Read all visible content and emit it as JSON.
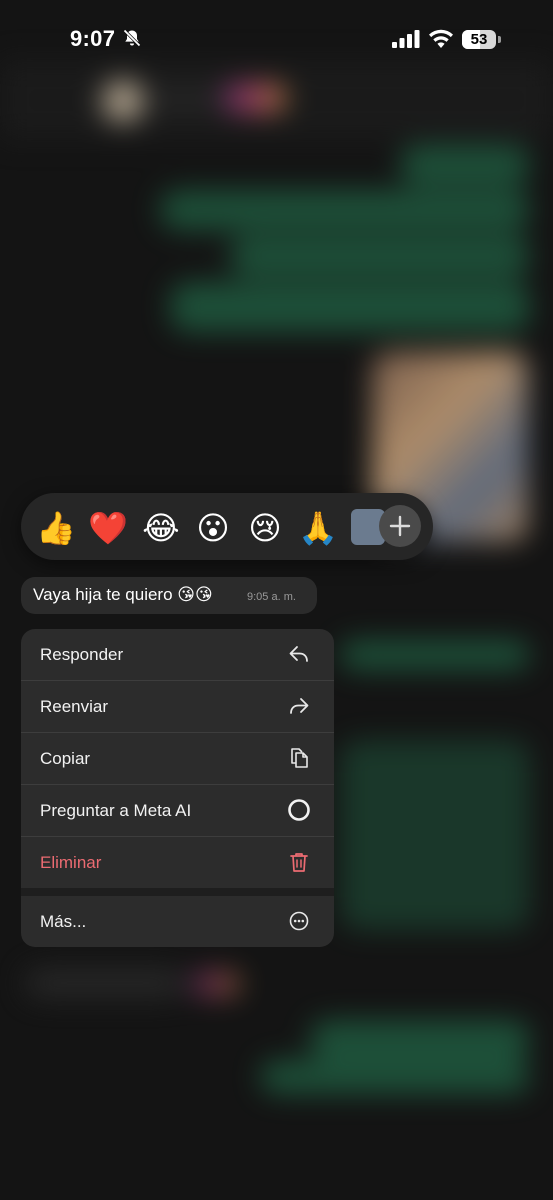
{
  "status_bar": {
    "time": "9:07",
    "battery": "53"
  },
  "reactions": {
    "emojis": [
      "👍",
      "❤️",
      "😂",
      "😮",
      "😢",
      "🙏"
    ],
    "more_icon": "plus-icon"
  },
  "message": {
    "text": "Vaya hija te quiero 😘😘",
    "time": "9:05 a. m."
  },
  "menu": {
    "items": [
      {
        "label": "Responder",
        "icon": "reply-icon"
      },
      {
        "label": "Reenviar",
        "icon": "forward-icon"
      },
      {
        "label": "Copiar",
        "icon": "copy-icon"
      },
      {
        "label": "Preguntar a Meta AI",
        "icon": "meta-ai-icon"
      },
      {
        "label": "Eliminar",
        "icon": "trash-icon"
      },
      {
        "label": "Más...",
        "icon": "more-icon"
      }
    ]
  },
  "colors": {
    "danger": "#ec6b72",
    "menu_bg": "#2c2c2c",
    "background": "#141414"
  }
}
